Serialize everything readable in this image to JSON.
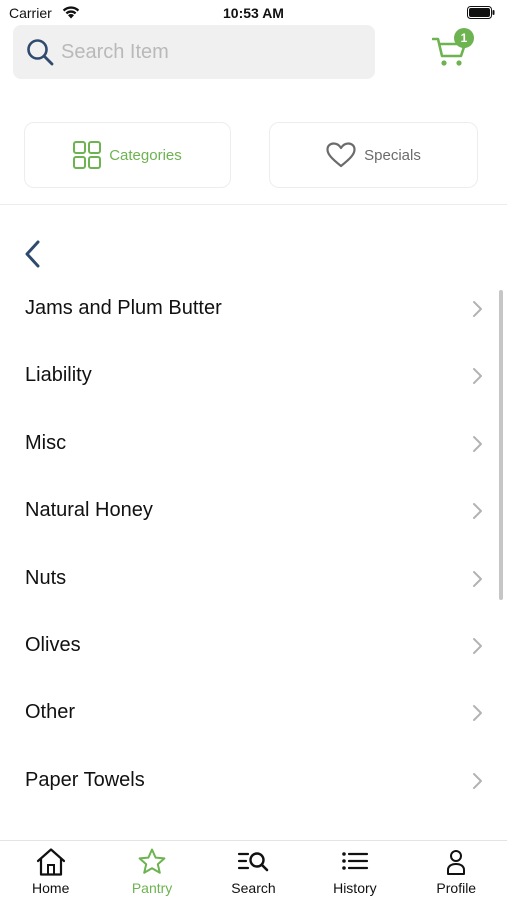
{
  "status_bar": {
    "carrier": "Carrier",
    "time": "10:53 AM"
  },
  "search": {
    "placeholder": "Search Item",
    "value": ""
  },
  "cart": {
    "count": "1"
  },
  "tabs": [
    {
      "label": "Categories",
      "active": true
    },
    {
      "label": "Specials",
      "active": false
    }
  ],
  "categories": [
    "Jams and Plum Butter",
    "Liability",
    "Misc",
    "Natural Honey",
    "Nuts",
    "Olives",
    "Other",
    "Paper Towels"
  ],
  "bottom_nav": [
    {
      "label": "Home",
      "icon": "home-icon"
    },
    {
      "label": "Pantry",
      "icon": "star-icon",
      "active": true
    },
    {
      "label": "Search",
      "icon": "list-search-icon"
    },
    {
      "label": "History",
      "icon": "list-icon"
    },
    {
      "label": "Profile",
      "icon": "person-icon"
    }
  ],
  "colors": {
    "accent": "#6db350",
    "back": "#2f4a6e",
    "text": "#111111"
  }
}
